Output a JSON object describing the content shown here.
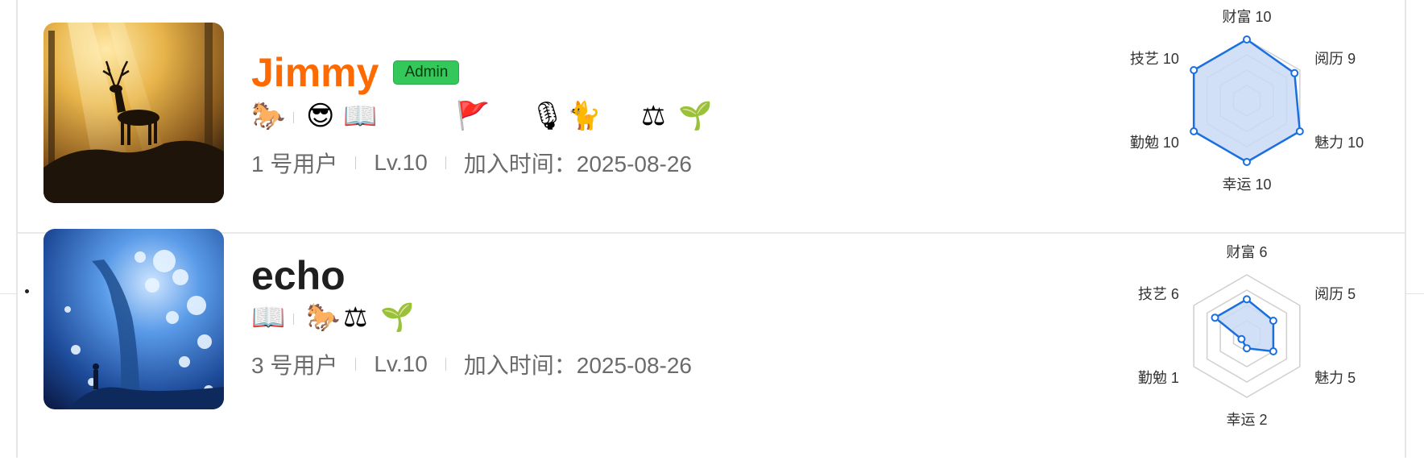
{
  "users": [
    {
      "name": "Jimmy",
      "name_color": "#ff6a00",
      "badge": "Admin",
      "emojis": [
        "🐎",
        "😎",
        "📖",
        "🚩",
        "🎙",
        "🐈",
        "⚖",
        "🌱"
      ],
      "user_no": "1 号用户",
      "level": "Lv.10",
      "joined": "加入时间：2025-08-26",
      "avatar": "deer-silhouette-sunlit-forest",
      "radar": {
        "labels": [
          "财富 10",
          "阅历 9",
          "魅力 10",
          "幸运 10",
          "勤勉 10",
          "技艺 10"
        ],
        "values": [
          10,
          9,
          10,
          10,
          10,
          10
        ],
        "max": 10
      }
    },
    {
      "name": "echo",
      "name_color": "#1f1f1f",
      "badge": "",
      "emojis": [
        "📖",
        "🐎",
        "⚖",
        "🌱"
      ],
      "user_no": "3 号用户",
      "level": "Lv.10",
      "joined": "加入时间：2025-08-26",
      "avatar": "glowing-blue-tree-fantasy",
      "radar": {
        "labels": [
          "财富 6",
          "阅历 5",
          "魅力 5",
          "幸运 2",
          "勤勉 1",
          "技艺 6"
        ],
        "values": [
          6,
          5,
          5,
          2,
          1,
          6
        ],
        "max": 10
      }
    }
  ],
  "colors": {
    "radar_stroke": "#1a6fe0",
    "radar_fill": "#c9dbf5",
    "grid": "#cfcfcf",
    "badge_bg": "#34c759"
  }
}
